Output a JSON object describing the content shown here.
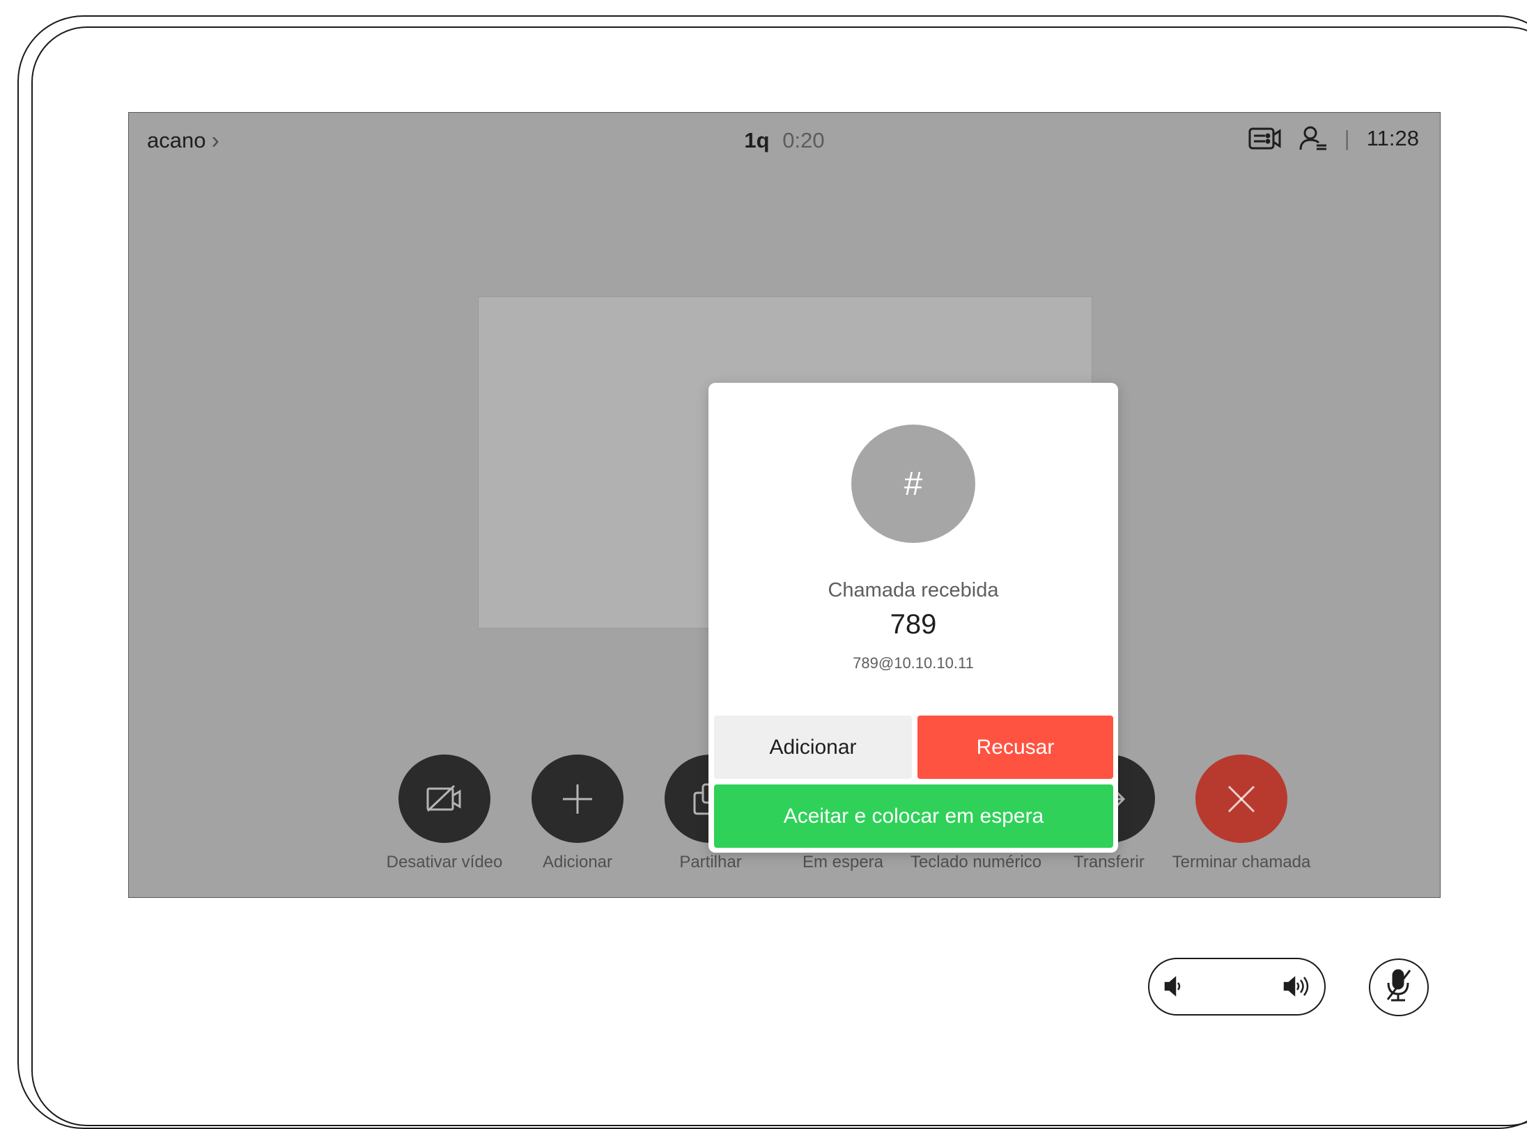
{
  "topbar": {
    "meeting_name": "acano",
    "call_id": "1q",
    "call_duration": "0:20",
    "time": "11:28",
    "icons": [
      "video-settings-icon",
      "contacts-icon",
      "chevron-right-icon"
    ]
  },
  "dialog": {
    "avatar_text": "#",
    "status": "Chamada recebida",
    "caller_number": "789",
    "caller_uri": "789@10.10.10.11",
    "add_label": "Adicionar",
    "decline_label": "Recusar",
    "accept_hold_label": "Aceitar e colocar em espera"
  },
  "controls": [
    {
      "label": "Desativar vídeo",
      "icon": "video-off-icon"
    },
    {
      "label": "Adicionar",
      "icon": "plus-icon"
    },
    {
      "label": "Partilhar",
      "icon": "share-icon"
    },
    {
      "label": "Em espera",
      "icon": "pause-icon"
    },
    {
      "label": "Teclado numérico",
      "icon": "keypad-icon"
    },
    {
      "label": "Transferir",
      "icon": "arrow-right-icon"
    },
    {
      "label": "Terminar chamada",
      "icon": "close-icon"
    }
  ],
  "colors": {
    "screen_bg": "#a3a3a3",
    "decline": "#ff5341",
    "accept": "#2fd159",
    "end_call": "#b83a2f",
    "control_bg": "#2b2b2b"
  },
  "hardware": {
    "icons": [
      "volume-down-icon",
      "volume-up-icon",
      "microphone-muted-icon"
    ]
  }
}
